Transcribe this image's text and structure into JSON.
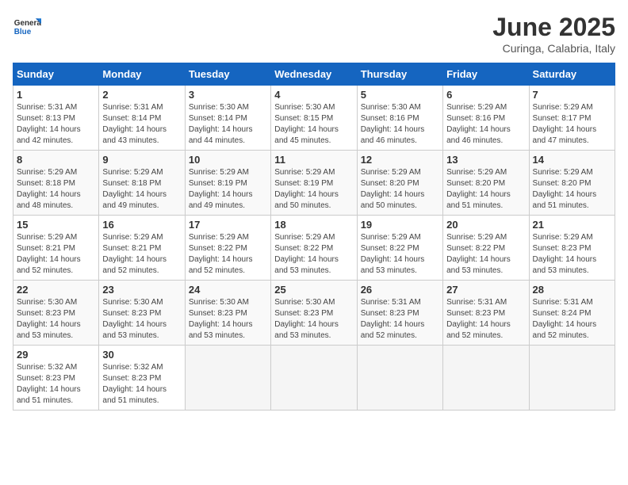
{
  "header": {
    "logo_general": "General",
    "logo_blue": "Blue",
    "month_title": "June 2025",
    "subtitle": "Curinga, Calabria, Italy"
  },
  "calendar": {
    "days_of_week": [
      "Sunday",
      "Monday",
      "Tuesday",
      "Wednesday",
      "Thursday",
      "Friday",
      "Saturday"
    ],
    "weeks": [
      [
        null,
        {
          "day": "2",
          "sunrise": "5:31 AM",
          "sunset": "8:14 PM",
          "daylight": "14 hours and 43 minutes."
        },
        {
          "day": "3",
          "sunrise": "5:30 AM",
          "sunset": "8:14 PM",
          "daylight": "14 hours and 44 minutes."
        },
        {
          "day": "4",
          "sunrise": "5:30 AM",
          "sunset": "8:15 PM",
          "daylight": "14 hours and 45 minutes."
        },
        {
          "day": "5",
          "sunrise": "5:30 AM",
          "sunset": "8:16 PM",
          "daylight": "14 hours and 46 minutes."
        },
        {
          "day": "6",
          "sunrise": "5:29 AM",
          "sunset": "8:16 PM",
          "daylight": "14 hours and 46 minutes."
        },
        {
          "day": "7",
          "sunrise": "5:29 AM",
          "sunset": "8:17 PM",
          "daylight": "14 hours and 47 minutes."
        }
      ],
      [
        {
          "day": "1",
          "sunrise": "5:31 AM",
          "sunset": "8:13 PM",
          "daylight": "14 hours and 42 minutes."
        },
        {
          "day": "8",
          "sunrise": "5:29 AM",
          "sunset": "8:18 PM",
          "daylight": "14 hours and 48 minutes."
        },
        {
          "day": "9",
          "sunrise": "5:29 AM",
          "sunset": "8:18 PM",
          "daylight": "14 hours and 49 minutes."
        },
        {
          "day": "10",
          "sunrise": "5:29 AM",
          "sunset": "8:19 PM",
          "daylight": "14 hours and 49 minutes."
        },
        {
          "day": "11",
          "sunrise": "5:29 AM",
          "sunset": "8:19 PM",
          "daylight": "14 hours and 50 minutes."
        },
        {
          "day": "12",
          "sunrise": "5:29 AM",
          "sunset": "8:20 PM",
          "daylight": "14 hours and 50 minutes."
        },
        {
          "day": "13",
          "sunrise": "5:29 AM",
          "sunset": "8:20 PM",
          "daylight": "14 hours and 51 minutes."
        },
        {
          "day": "14",
          "sunrise": "5:29 AM",
          "sunset": "8:20 PM",
          "daylight": "14 hours and 51 minutes."
        }
      ],
      [
        {
          "day": "15",
          "sunrise": "5:29 AM",
          "sunset": "8:21 PM",
          "daylight": "14 hours and 52 minutes."
        },
        {
          "day": "16",
          "sunrise": "5:29 AM",
          "sunset": "8:21 PM",
          "daylight": "14 hours and 52 minutes."
        },
        {
          "day": "17",
          "sunrise": "5:29 AM",
          "sunset": "8:22 PM",
          "daylight": "14 hours and 52 minutes."
        },
        {
          "day": "18",
          "sunrise": "5:29 AM",
          "sunset": "8:22 PM",
          "daylight": "14 hours and 53 minutes."
        },
        {
          "day": "19",
          "sunrise": "5:29 AM",
          "sunset": "8:22 PM",
          "daylight": "14 hours and 53 minutes."
        },
        {
          "day": "20",
          "sunrise": "5:29 AM",
          "sunset": "8:22 PM",
          "daylight": "14 hours and 53 minutes."
        },
        {
          "day": "21",
          "sunrise": "5:29 AM",
          "sunset": "8:23 PM",
          "daylight": "14 hours and 53 minutes."
        }
      ],
      [
        {
          "day": "22",
          "sunrise": "5:30 AM",
          "sunset": "8:23 PM",
          "daylight": "14 hours and 53 minutes."
        },
        {
          "day": "23",
          "sunrise": "5:30 AM",
          "sunset": "8:23 PM",
          "daylight": "14 hours and 53 minutes."
        },
        {
          "day": "24",
          "sunrise": "5:30 AM",
          "sunset": "8:23 PM",
          "daylight": "14 hours and 53 minutes."
        },
        {
          "day": "25",
          "sunrise": "5:30 AM",
          "sunset": "8:23 PM",
          "daylight": "14 hours and 53 minutes."
        },
        {
          "day": "26",
          "sunrise": "5:31 AM",
          "sunset": "8:23 PM",
          "daylight": "14 hours and 52 minutes."
        },
        {
          "day": "27",
          "sunrise": "5:31 AM",
          "sunset": "8:23 PM",
          "daylight": "14 hours and 52 minutes."
        },
        {
          "day": "28",
          "sunrise": "5:31 AM",
          "sunset": "8:24 PM",
          "daylight": "14 hours and 52 minutes."
        }
      ],
      [
        {
          "day": "29",
          "sunrise": "5:32 AM",
          "sunset": "8:23 PM",
          "daylight": "14 hours and 51 minutes."
        },
        {
          "day": "30",
          "sunrise": "5:32 AM",
          "sunset": "8:23 PM",
          "daylight": "14 hours and 51 minutes."
        },
        null,
        null,
        null,
        null,
        null
      ]
    ]
  }
}
